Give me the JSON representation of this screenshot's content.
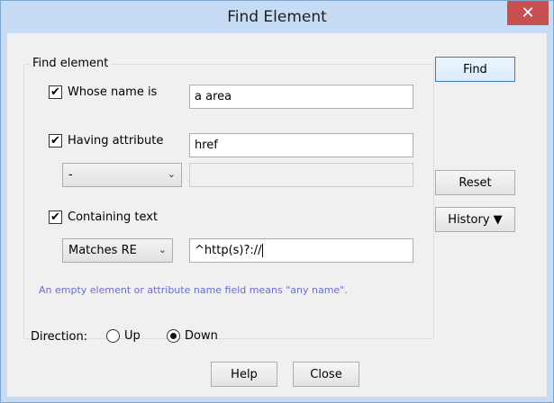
{
  "window": {
    "title": "Find Element",
    "close_glyph": "✕"
  },
  "group": {
    "legend": "Find element"
  },
  "name_filter": {
    "label": "Whose name is",
    "checked": true,
    "value": "a area"
  },
  "attribute_filter": {
    "label": "Having attribute",
    "checked": true,
    "value": "href"
  },
  "attribute_operator": {
    "selected": "-",
    "value": ""
  },
  "text_filter": {
    "label": "Containing text",
    "checked": true
  },
  "text_operator": {
    "selected": "Matches RE",
    "value": "^http(s)?://"
  },
  "hint": "An empty element or attribute name field means \"any name\".",
  "direction": {
    "label": "Direction:",
    "up_label": "Up",
    "down_label": "Down",
    "selected": "Down"
  },
  "buttons": {
    "find": "Find",
    "reset": "Reset",
    "history": "History ▼",
    "help": "Help",
    "close": "Close"
  },
  "icons": {
    "check": "✔",
    "chevron": "⌄"
  }
}
